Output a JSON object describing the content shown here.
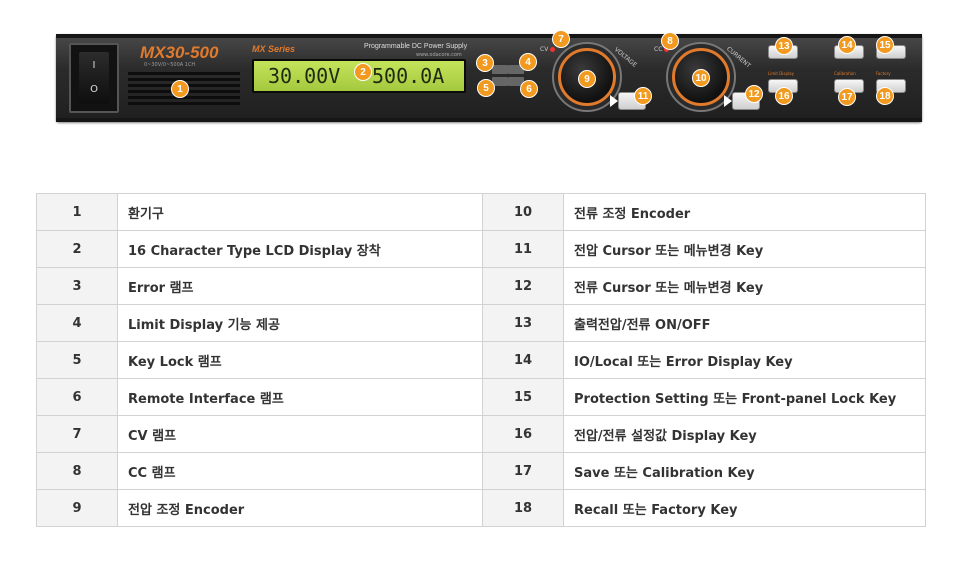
{
  "device": {
    "logo_text": "MX30-500",
    "logo_sub": "0~30V/0~500A 1CH",
    "series": "MX Series",
    "product_name": "Programmable DC Power Supply",
    "product_url": "www.odacore.com",
    "switch_on": "I",
    "switch_off": "O",
    "lcd_voltage": "30.00V",
    "lcd_current": "500.0A",
    "label_cv": "CV",
    "label_cc": "CC",
    "dial_voltage": "VOLTAGE",
    "dial_current": "CURRENT",
    "caption_limit_display": "Limit Display",
    "caption_calibration": "Calibration",
    "caption_factory": "Factory",
    "callouts": [
      "1",
      "2",
      "3",
      "4",
      "5",
      "6",
      "7",
      "8",
      "9",
      "10",
      "11",
      "12",
      "13",
      "14",
      "15",
      "16",
      "17",
      "18"
    ]
  },
  "legend": {
    "rows": [
      {
        "left_num": "1",
        "left_desc": "환기구",
        "right_num": "10",
        "right_desc": "전류 조정 Encoder"
      },
      {
        "left_num": "2",
        "left_desc": "16 Character Type LCD Display 장착",
        "right_num": "11",
        "right_desc": "전압 Cursor 또는 메뉴변경 Key"
      },
      {
        "left_num": "3",
        "left_desc": "Error 램프",
        "right_num": "12",
        "right_desc": "전류 Cursor 또는 메뉴변경 Key"
      },
      {
        "left_num": "4",
        "left_desc": "Limit Display 기능 제공",
        "right_num": "13",
        "right_desc": "출력전압/전류 ON/OFF"
      },
      {
        "left_num": "5",
        "left_desc": "Key Lock 램프",
        "right_num": "14",
        "right_desc": "IO/Local 또는 Error Display Key"
      },
      {
        "left_num": "6",
        "left_desc": "Remote Interface 램프",
        "right_num": "15",
        "right_desc": "Protection Setting 또는 Front-panel Lock Key"
      },
      {
        "left_num": "7",
        "left_desc": "CV 램프",
        "right_num": "16",
        "right_desc": "전압/전류 설정값 Display Key"
      },
      {
        "left_num": "8",
        "left_desc": "CC 램프",
        "right_num": "17",
        "right_desc": "Save 또는 Calibration Key"
      },
      {
        "left_num": "9",
        "left_desc": "전압 조정 Encoder",
        "right_num": "18",
        "right_desc": "Recall 또는 Factory Key"
      }
    ]
  }
}
